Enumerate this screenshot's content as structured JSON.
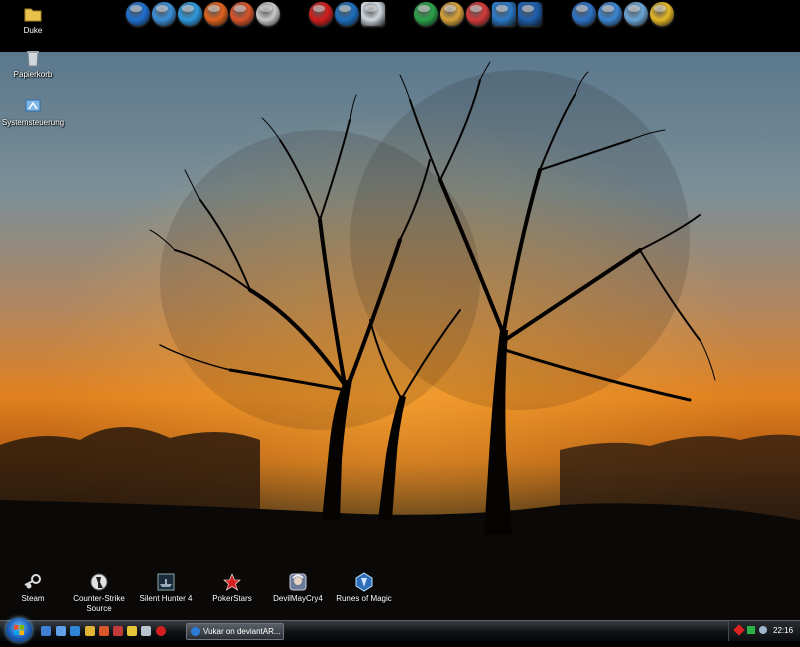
{
  "desktop": {
    "top_icons": [
      {
        "label": "Duke",
        "icon": "folder-icon"
      },
      {
        "label": "Papierkorb",
        "icon": "recycle-bin-icon"
      },
      {
        "label": "Systemsteuerung",
        "icon": "control-panel-icon"
      }
    ],
    "bottom_icons": [
      {
        "label": "Steam",
        "icon": "steam-icon"
      },
      {
        "label": "Counter-Strike Source",
        "icon": "counter-strike-icon"
      },
      {
        "label": "Silent Hunter 4",
        "icon": "silent-hunter-icon"
      },
      {
        "label": "PokerStars",
        "icon": "pokerstars-icon"
      },
      {
        "label": "DevilMayCry4",
        "icon": "devil-may-cry-icon"
      },
      {
        "label": "Runes of Magic",
        "icon": "runes-of-magic-icon"
      }
    ]
  },
  "dock": {
    "icons": [
      {
        "name": "browser-globe-icon",
        "color": "#1f6fd0"
      },
      {
        "name": "document-app-icon",
        "color": "#3a8fd8"
      },
      {
        "name": "messenger-icon",
        "color": "#2e9ae0"
      },
      {
        "name": "firefox-icon",
        "color": "#e0621c"
      },
      {
        "name": "media-player-icon",
        "color": "#d9542a"
      },
      {
        "name": "tools-icon",
        "color": "#c9c9c9"
      },
      {
        "name": "red-ball-icon",
        "color": "#d21d1d"
      },
      {
        "name": "network-globe-icon",
        "color": "#1c6fbf"
      },
      {
        "name": "notepad-icon",
        "color": "#cfd8e0"
      },
      {
        "name": "green-globe-icon",
        "color": "#2aa34a"
      },
      {
        "name": "paint-icon",
        "color": "#d8a23a"
      },
      {
        "name": "music-app-icon",
        "color": "#d23a3a"
      },
      {
        "name": "picture-viewer-icon",
        "color": "#2a7ac8"
      },
      {
        "name": "camera-icon",
        "color": "#1e5fb0"
      },
      {
        "name": "google-earth-icon",
        "color": "#2d72c6"
      },
      {
        "name": "compass-icon",
        "color": "#3b86d4"
      },
      {
        "name": "settings-tools-icon",
        "color": "#6aa6d8"
      },
      {
        "name": "puzzle-icon",
        "color": "#e5b826"
      }
    ]
  },
  "taskbar": {
    "task_label": "Vukar on deviantAR...",
    "clock": "22:16",
    "quicklaunch": [
      {
        "name": "show-desktop-icon",
        "color": "#3f7fd4"
      },
      {
        "name": "switch-windows-icon",
        "color": "#5fa0e6"
      },
      {
        "name": "ie-quicklaunch-icon",
        "color": "#2f86d8"
      },
      {
        "name": "explorer-quicklaunch-icon",
        "color": "#e0b437"
      },
      {
        "name": "media-quicklaunch-icon",
        "color": "#d8572a"
      },
      {
        "name": "tool-quicklaunch-icon",
        "color": "#c23a3a"
      },
      {
        "name": "winamp-quicklaunch-icon",
        "color": "#e6c63a"
      },
      {
        "name": "mail-quicklaunch-icon",
        "color": "#b8c4d0"
      },
      {
        "name": "stop-quicklaunch-icon",
        "color": "#d42020"
      }
    ]
  }
}
